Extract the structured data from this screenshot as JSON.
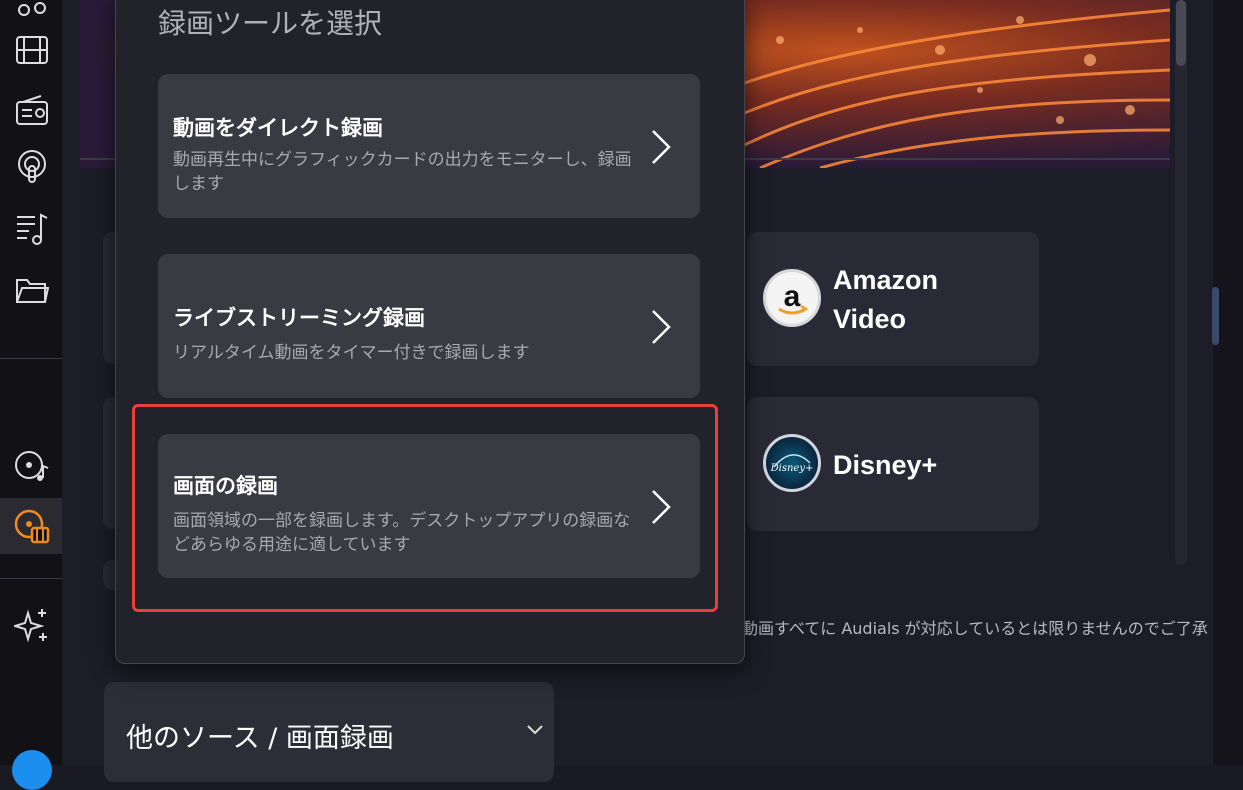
{
  "popup": {
    "title": "録画ツールを選択",
    "options": [
      {
        "title": "動画をダイレクト録画",
        "description": "動画再生中にグラフィックカードの出力をモニターし、録画します"
      },
      {
        "title": "ライブストリーミング録画",
        "description": "リアルタイム動画をタイマー付きで録画します"
      },
      {
        "title": "画面の録画",
        "description": "画面領域の一部を録画します。デスクトップアプリの録画などあらゆる用途に適しています"
      }
    ]
  },
  "services": [
    {
      "name": "Amazon Video",
      "name_line1": "Amazon",
      "name_line2": "Video",
      "icon": "amazon-logo-icon"
    },
    {
      "name": "Disney+",
      "icon": "disney-plus-logo-icon"
    }
  ],
  "disclaimer": "動画すべてに Audials が対応しているとは限りませんのでご了承",
  "dropdown": {
    "label": "他のソース / 画面録画"
  },
  "sidebar": {
    "icons": [
      "film-icon",
      "radio-icon",
      "podcast-icon",
      "music-playlist-icon",
      "folder-icon",
      "music-cd-icon",
      "video-recorder-icon",
      "ai-sparkle-icon"
    ]
  },
  "colors": {
    "highlight": "#e8403c",
    "accent": "#f08a1c",
    "sidebar_bottom": "#1c8ef0"
  }
}
